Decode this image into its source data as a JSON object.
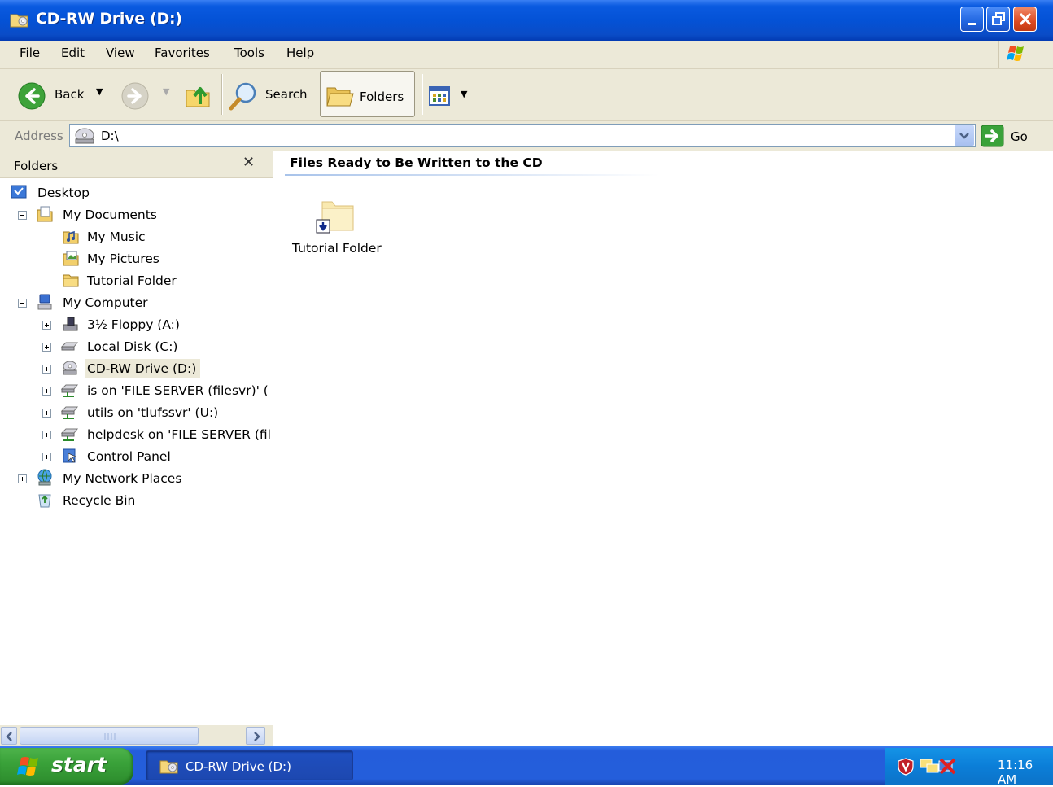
{
  "window": {
    "title": "CD-RW Drive (D:)"
  },
  "menu": {
    "items": [
      "File",
      "Edit",
      "View",
      "Favorites",
      "Tools",
      "Help"
    ]
  },
  "toolbar": {
    "back_label": "Back",
    "search_label": "Search",
    "folders_label": "Folders"
  },
  "address": {
    "label": "Address",
    "value": "D:\\",
    "go_label": "Go"
  },
  "folders_pane": {
    "title": "Folders",
    "close_glyph": "✕",
    "tree": [
      {
        "label": "Desktop",
        "icon": "desktop-icon",
        "level": 0,
        "expander": "none"
      },
      {
        "label": "My Documents",
        "icon": "my-documents-icon",
        "level": 1,
        "expander": "minus"
      },
      {
        "label": "My Music",
        "icon": "my-music-icon",
        "level": 2,
        "expander": "none"
      },
      {
        "label": "My Pictures",
        "icon": "my-pictures-icon",
        "level": 2,
        "expander": "none"
      },
      {
        "label": "Tutorial Folder",
        "icon": "folder-icon",
        "level": 2,
        "expander": "none"
      },
      {
        "label": "My Computer",
        "icon": "my-computer-icon",
        "level": 1,
        "expander": "minus"
      },
      {
        "label": "3½ Floppy (A:)",
        "icon": "floppy-icon",
        "level": 2,
        "expander": "plus"
      },
      {
        "label": "Local Disk (C:)",
        "icon": "hard-disk-icon",
        "level": 2,
        "expander": "plus"
      },
      {
        "label": "CD-RW Drive (D:)",
        "icon": "cd-drive-icon",
        "level": 2,
        "expander": "plus",
        "selected": true
      },
      {
        "label": "is on 'FILE SERVER (filesvr)' (",
        "icon": "network-drive-icon",
        "level": 2,
        "expander": "plus"
      },
      {
        "label": "utils on 'tlufssvr' (U:)",
        "icon": "network-drive-icon",
        "level": 2,
        "expander": "plus"
      },
      {
        "label": "helpdesk on 'FILE SERVER (fil",
        "icon": "network-drive-icon",
        "level": 2,
        "expander": "plus"
      },
      {
        "label": "Control Panel",
        "icon": "control-panel-icon",
        "level": 2,
        "expander": "plus"
      },
      {
        "label": "My Network Places",
        "icon": "network-places-icon",
        "level": 1,
        "expander": "plus"
      },
      {
        "label": "Recycle Bin",
        "icon": "recycle-bin-icon",
        "level": 1,
        "expander": "none"
      }
    ]
  },
  "content": {
    "group_title": "Files Ready to Be Written to the CD",
    "items": [
      {
        "label": "Tutorial Folder",
        "icon": "folder-pending-icon"
      }
    ]
  },
  "taskbar": {
    "start_label": "start",
    "task_label": "CD-RW Drive (D:)",
    "clock": "11:16 AM"
  },
  "colors": {
    "titlebar": "#0452d6",
    "taskbar": "#245edb",
    "start": "#3aa23a",
    "chrome": "#ece9d8"
  }
}
